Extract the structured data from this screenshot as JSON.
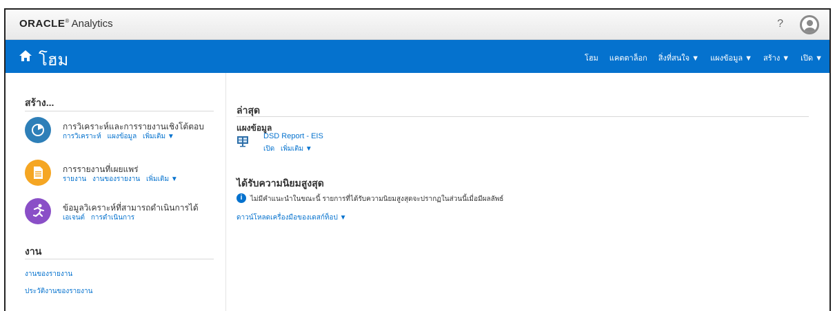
{
  "brand": {
    "oracle": "ORACLE",
    "analytics": "Analytics"
  },
  "help_label": "?",
  "header": {
    "title": "โฮม",
    "nav": [
      "โฮม",
      "แคตตาล็อก",
      "สิ่งที่สนใจ ▼",
      "แผงข้อมูล ▼",
      "สร้าง ▼",
      "เปิด ▼"
    ]
  },
  "left": {
    "create_heading": "สร้าง...",
    "items": [
      {
        "title": "การวิเคราะห์และการรายงานเชิงโต้ตอบ",
        "links": [
          "การวิเคราะห์",
          "แผงข้อมูล",
          "เพิ่มเติม ▼"
        ],
        "color": "#2e7fb8",
        "icon": "pie-chart-icon"
      },
      {
        "title": "การรายงานที่เผยแพร่",
        "links": [
          "รายงาน",
          "งานของรายงาน",
          "เพิ่มเติม ▼"
        ],
        "color": "#f5a623",
        "icon": "document-icon"
      },
      {
        "title": "ข้อมูลวิเคราะห์ที่สามารถดำเนินการได้",
        "links": [
          "เอเจนต์",
          "การดำเนินการ"
        ],
        "color": "#8a4fc7",
        "icon": "running-person-icon"
      }
    ],
    "work_heading": "งาน",
    "work_links": [
      "งานของรายงาน",
      "ประวัติงานของรายงาน"
    ]
  },
  "right": {
    "recent_heading": "ล่าสุด",
    "dashboards_subheading": "แผงข้อมูล",
    "recent_item": {
      "title": "DSD Report - EIS",
      "links": [
        "เปิด",
        "เพิ่มเติม ▼"
      ],
      "icon": "dashboard-icon"
    },
    "popular_heading": "ได้รับความนิยมสูงสุด",
    "popular_info": "ไม่มีคำแนะนำในขณะนี้ รายการที่ได้รับความนิยมสูงสุดจะปรากฏในส่วนนี้เมื่อมีผลลัพธ์",
    "download_link": "ดาวน์โหลดเครื่องมือของเดสก์ท็อป ▼"
  },
  "colors": {
    "accent": "#0572ce"
  }
}
